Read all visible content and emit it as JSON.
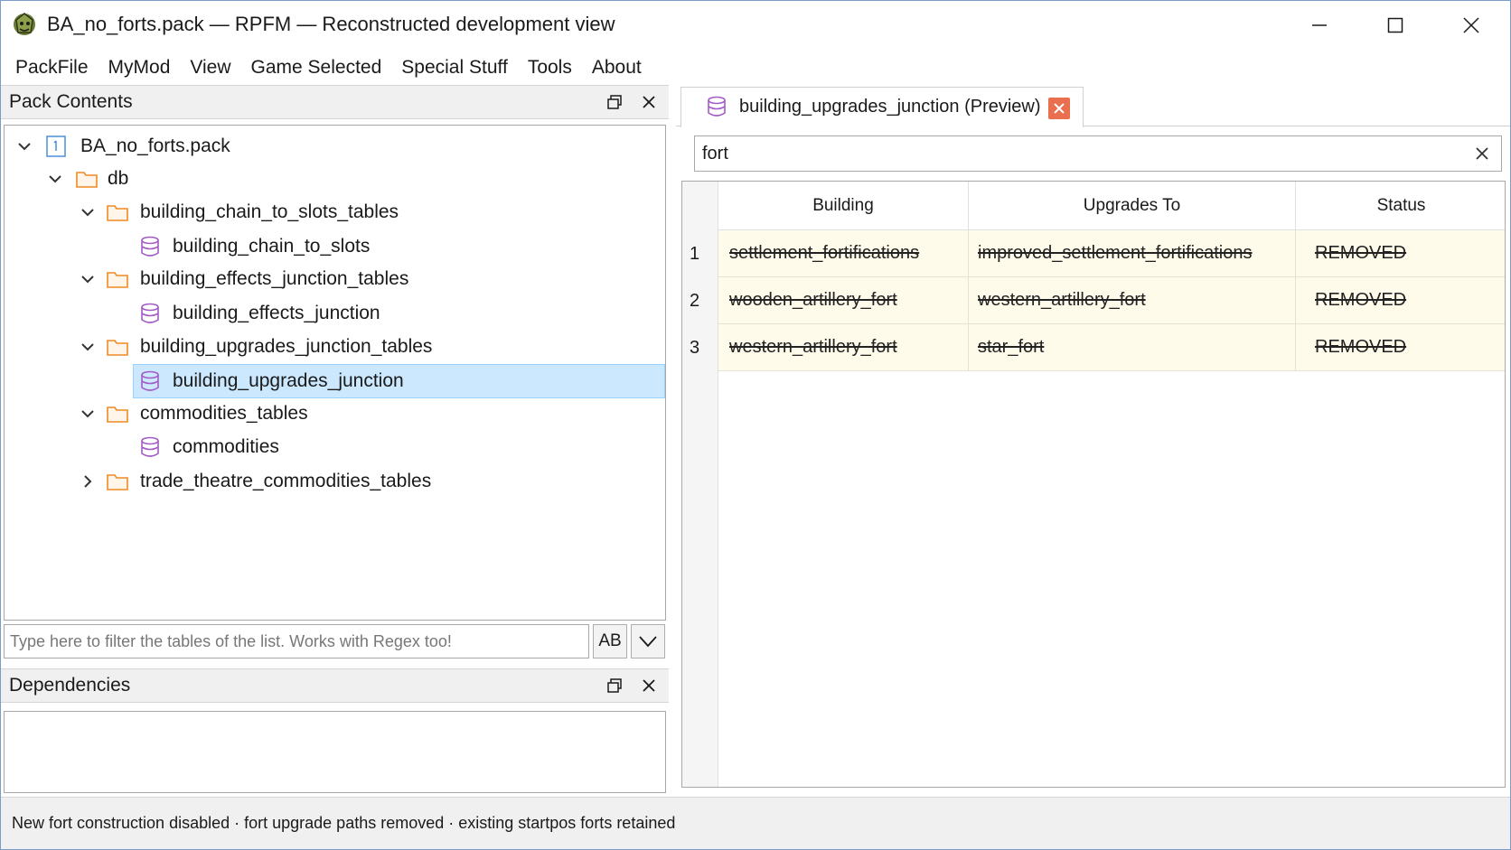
{
  "window": {
    "title": "BA_no_forts.pack — RPFM — Reconstructed development view",
    "app_icon": "rpfm-logo-icon"
  },
  "menu": {
    "items": [
      "PackFile",
      "MyMod",
      "View",
      "Game Selected",
      "Special Stuff",
      "Tools",
      "About"
    ]
  },
  "pack_contents": {
    "title": "Pack Contents",
    "tree": [
      {
        "label": "BA_no_forts.pack",
        "type": "pack",
        "expanded": true,
        "depth": 0
      },
      {
        "label": "db",
        "type": "folder",
        "expanded": true,
        "depth": 1
      },
      {
        "label": "building_chain_to_slots_tables",
        "type": "folder",
        "expanded": true,
        "depth": 2
      },
      {
        "label": "building_chain_to_slots",
        "type": "table",
        "depth": 3
      },
      {
        "label": "building_effects_junction_tables",
        "type": "folder",
        "expanded": true,
        "depth": 2
      },
      {
        "label": "building_effects_junction",
        "type": "table",
        "depth": 3
      },
      {
        "label": "building_upgrades_junction_tables",
        "type": "folder",
        "expanded": true,
        "depth": 2
      },
      {
        "label": "building_upgrades_junction",
        "type": "table",
        "depth": 3,
        "selected": true
      },
      {
        "label": "commodities_tables",
        "type": "folder",
        "expanded": true,
        "depth": 2
      },
      {
        "label": "commodities",
        "type": "table",
        "depth": 3
      },
      {
        "label": "trade_theatre_commodities_tables",
        "type": "folder",
        "expanded": false,
        "depth": 2
      }
    ],
    "filter_placeholder": "Type here to filter the tables of the list. Works with Regex too!",
    "case_button_label": "AB"
  },
  "dependencies": {
    "title": "Dependencies"
  },
  "editor": {
    "tab_label": "building_upgrades_junction (Preview)",
    "search_value": "fort",
    "columns": [
      "Building",
      "Upgrades To",
      "Status"
    ],
    "rows": [
      {
        "num": "1",
        "building": "settlement_fortifications",
        "upgrades_to": "improved_settlement_fortifications",
        "status": "REMOVED"
      },
      {
        "num": "2",
        "building": "wooden_artillery_fort",
        "upgrades_to": "western_artillery_fort",
        "status": "REMOVED"
      },
      {
        "num": "3",
        "building": "western_artillery_fort",
        "upgrades_to": "star_fort",
        "status": "REMOVED"
      }
    ]
  },
  "status_bar": {
    "text": "New fort construction disabled · fort upgrade paths removed · existing startpos forts retained"
  },
  "colors": {
    "selection": "#cce8ff",
    "folder": "#f08a24",
    "table_icon": "#a35bc7",
    "row_highlight": "#fffbea",
    "tab_close": "#e96f4e"
  }
}
